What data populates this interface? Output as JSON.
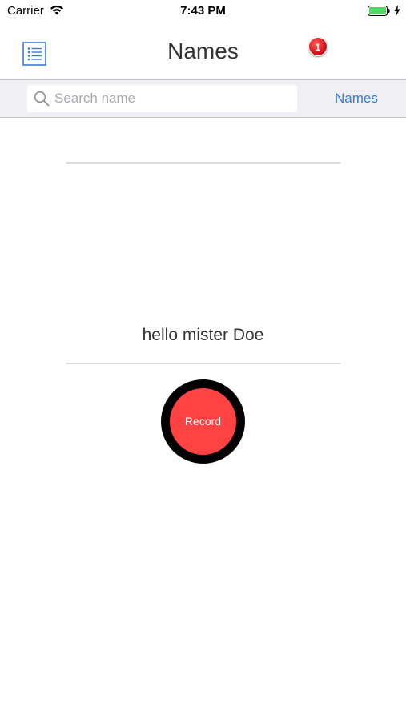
{
  "status_bar": {
    "carrier": "Carrier",
    "time": "7:43 PM",
    "icons": [
      "wifi-icon",
      "battery-icon",
      "charging-bolt-icon"
    ],
    "battery_color": "#4cd964"
  },
  "nav": {
    "menu_icon": "list-icon",
    "title": "Names",
    "badge_count": "1",
    "badge_color": "#d4151b"
  },
  "search": {
    "placeholder": "Search name",
    "value": "",
    "icon": "search-icon",
    "scope_label": "Names",
    "accent_color": "#3a7bd5"
  },
  "content": {
    "message": "hello mister  Doe",
    "record_label": "Record",
    "record_color": "#ff4242"
  }
}
